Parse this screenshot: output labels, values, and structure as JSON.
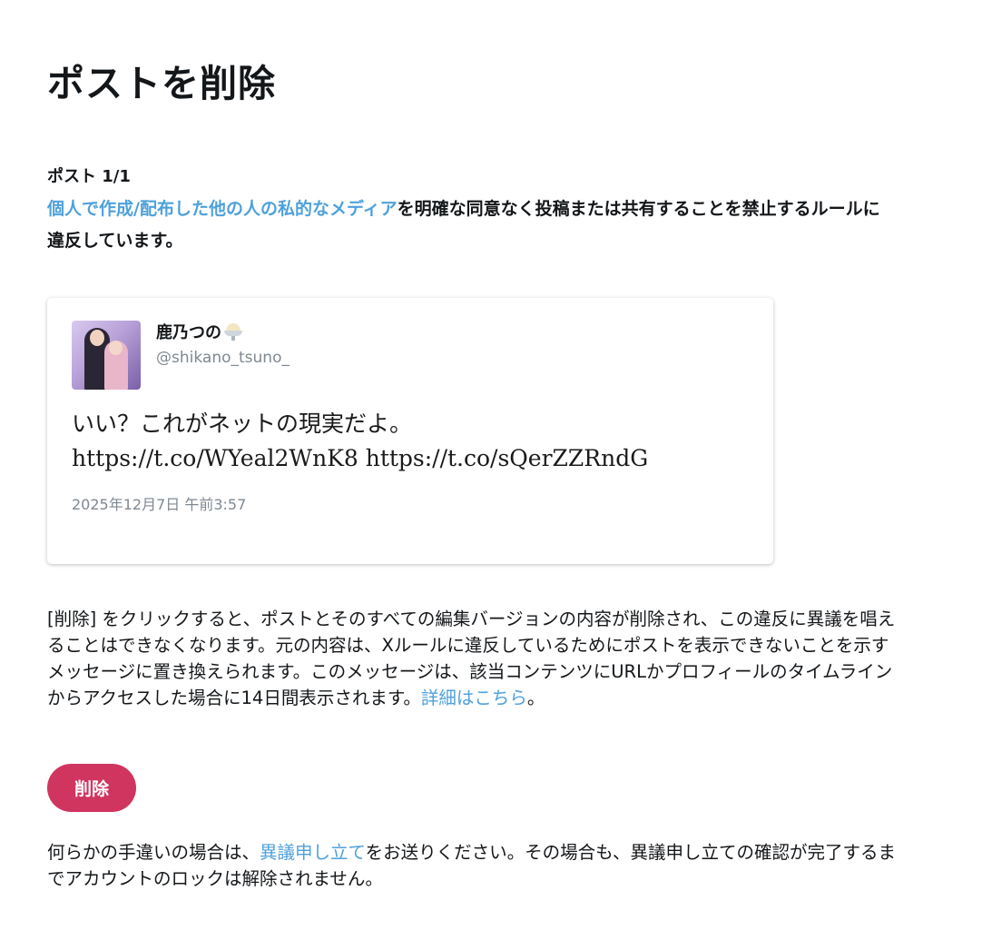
{
  "page": {
    "title": "ポストを削除"
  },
  "post_count": "ポスト 1/1",
  "violation": {
    "link_text": "個人で作成/配布した他の人の私的なメディア",
    "rest_text": "を明確な同意なく投稿または共有することを禁止するルールに違反しています。"
  },
  "tweet": {
    "author_name": "鹿乃つの",
    "author_emoji_icon": "shaved-ice-icon",
    "author_handle": "@shikano_tsuno_",
    "text_line1": "いい？これがネットの現実だよ。",
    "text_line2": "https://t.co/WYeal2WnK8 https://t.co/sQerZZRndG",
    "date": "2025年12月7日 午前3:57"
  },
  "explanation": {
    "text": "[削除] をクリックすると、ポストとそのすべての編集バージョンの内容が削除され、この違反に異議を唱えることはできなくなります。元の内容は、Xルールに違反しているためにポストを表示できないことを示すメッセージに置き換えられます。このメッセージは、該当コンテンツにURLかプロフィールのタイムラインからアクセスした場合に14日間表示されます。",
    "link_text": "詳細はこちら",
    "suffix": "。"
  },
  "delete_button": {
    "label": "削除",
    "color": "#d0355f"
  },
  "appeal": {
    "prefix": "何らかの手違いの場合は、",
    "link_text": "異議申し立て",
    "suffix": "をお送りください。その場合も、異議申し立ての確認が完了するまでアカウントのロックは解除されません。"
  },
  "colors": {
    "link": "#4fa1db",
    "text": "#14171a",
    "muted": "#7f8891"
  }
}
